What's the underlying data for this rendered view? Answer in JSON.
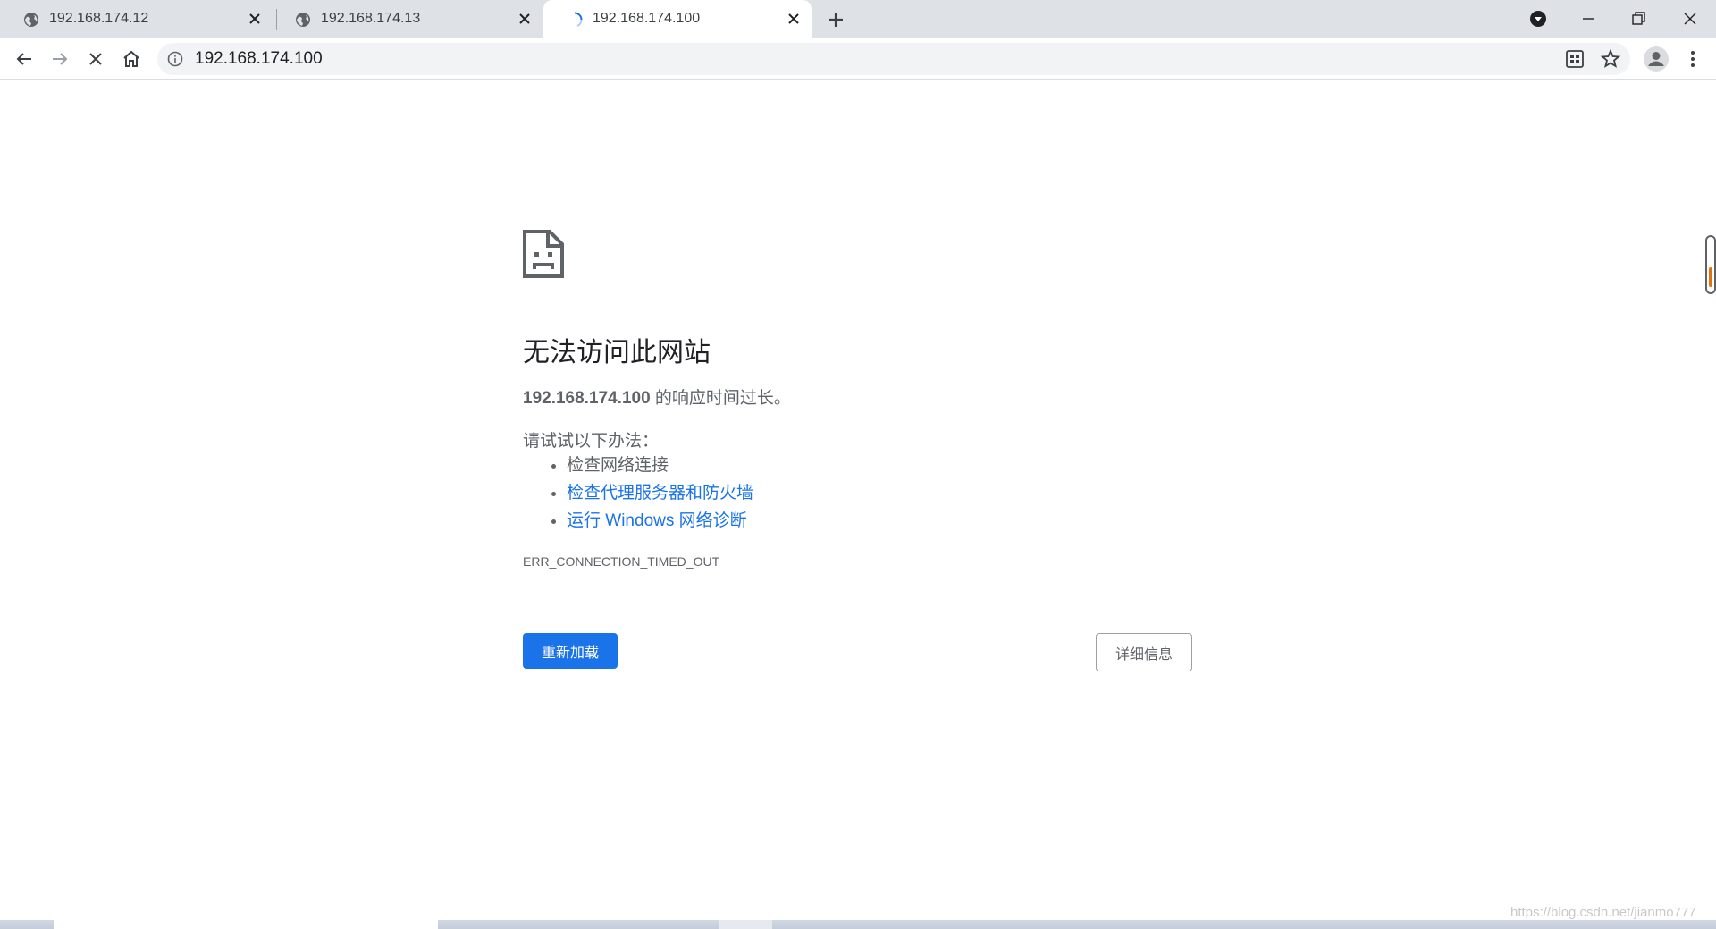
{
  "tabs": [
    {
      "title": "192.168.174.12",
      "icon": "globe-icon",
      "state": "loaded"
    },
    {
      "title": "192.168.174.13",
      "icon": "globe-icon",
      "state": "loaded"
    },
    {
      "title": "192.168.174.100",
      "icon": "loading-spinner-icon",
      "state": "loading"
    }
  ],
  "toolbar": {
    "url": "192.168.174.100"
  },
  "error": {
    "title": "无法访问此网站",
    "host": "192.168.174.100",
    "summary_suffix": " 的响应时间过长。",
    "try_heading": "请试试以下办法：",
    "suggestions": [
      {
        "text": "检查网络连接",
        "link": false
      },
      {
        "text": "检查代理服务器和防火墙",
        "link": true
      },
      {
        "text": "运行 Windows 网络诊断",
        "link": true
      }
    ],
    "code": "ERR_CONNECTION_TIMED_OUT",
    "reload_label": "重新加载",
    "details_label": "详细信息"
  },
  "watermark": "https://blog.csdn.net/jianmo777",
  "colors": {
    "accent": "#1a73e8",
    "tabstrip": "#dee1e6",
    "omnibox": "#f1f3f4",
    "text_secondary": "#5f6368"
  }
}
